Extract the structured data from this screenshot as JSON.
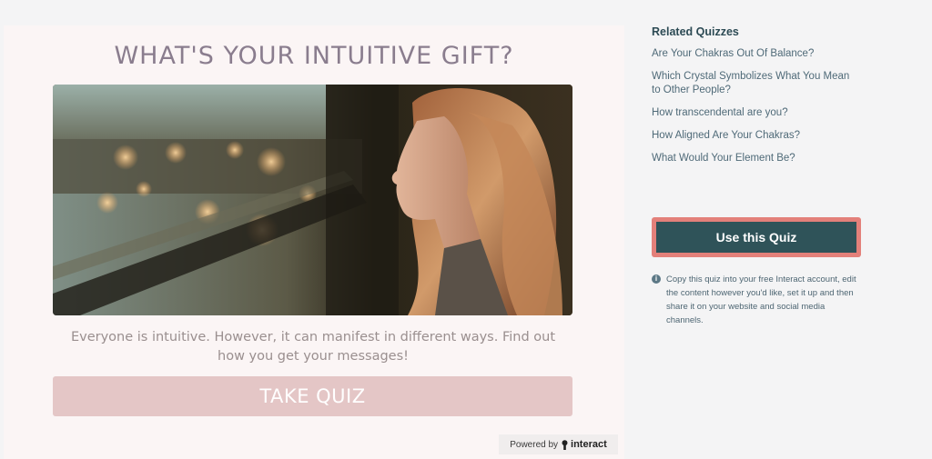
{
  "quiz": {
    "title": "WHAT'S YOUR INTUITIVE GIFT?",
    "description": "Everyone is intuitive. However, it can manifest in different ways. Find out how you get your messages!",
    "take_label": "TAKE QUIZ",
    "powered_by_label": "Powered by",
    "powered_by_brand": "interact"
  },
  "sidebar": {
    "heading": "Related Quizzes",
    "related": [
      "Are Your Chakras Out Of Balance?",
      "Which Crystal Symbolizes What You Mean to Other People?",
      "How transcendental are you?",
      "How Aligned Are Your Chakras?",
      "What Would Your Element Be?"
    ],
    "use_label": "Use this Quiz",
    "info_icon": "info-icon",
    "info_text": "Copy this quiz into your free Interact account, edit the content however you'd like, set it up and then share it on your website and social media channels."
  },
  "colors": {
    "card_bg": "#fbf5f5",
    "title": "#8a7d8e",
    "take_button": "#e4c6c6",
    "use_button": "#2f5359",
    "use_button_outline": "#e3807a",
    "link": "#4f6a78"
  }
}
